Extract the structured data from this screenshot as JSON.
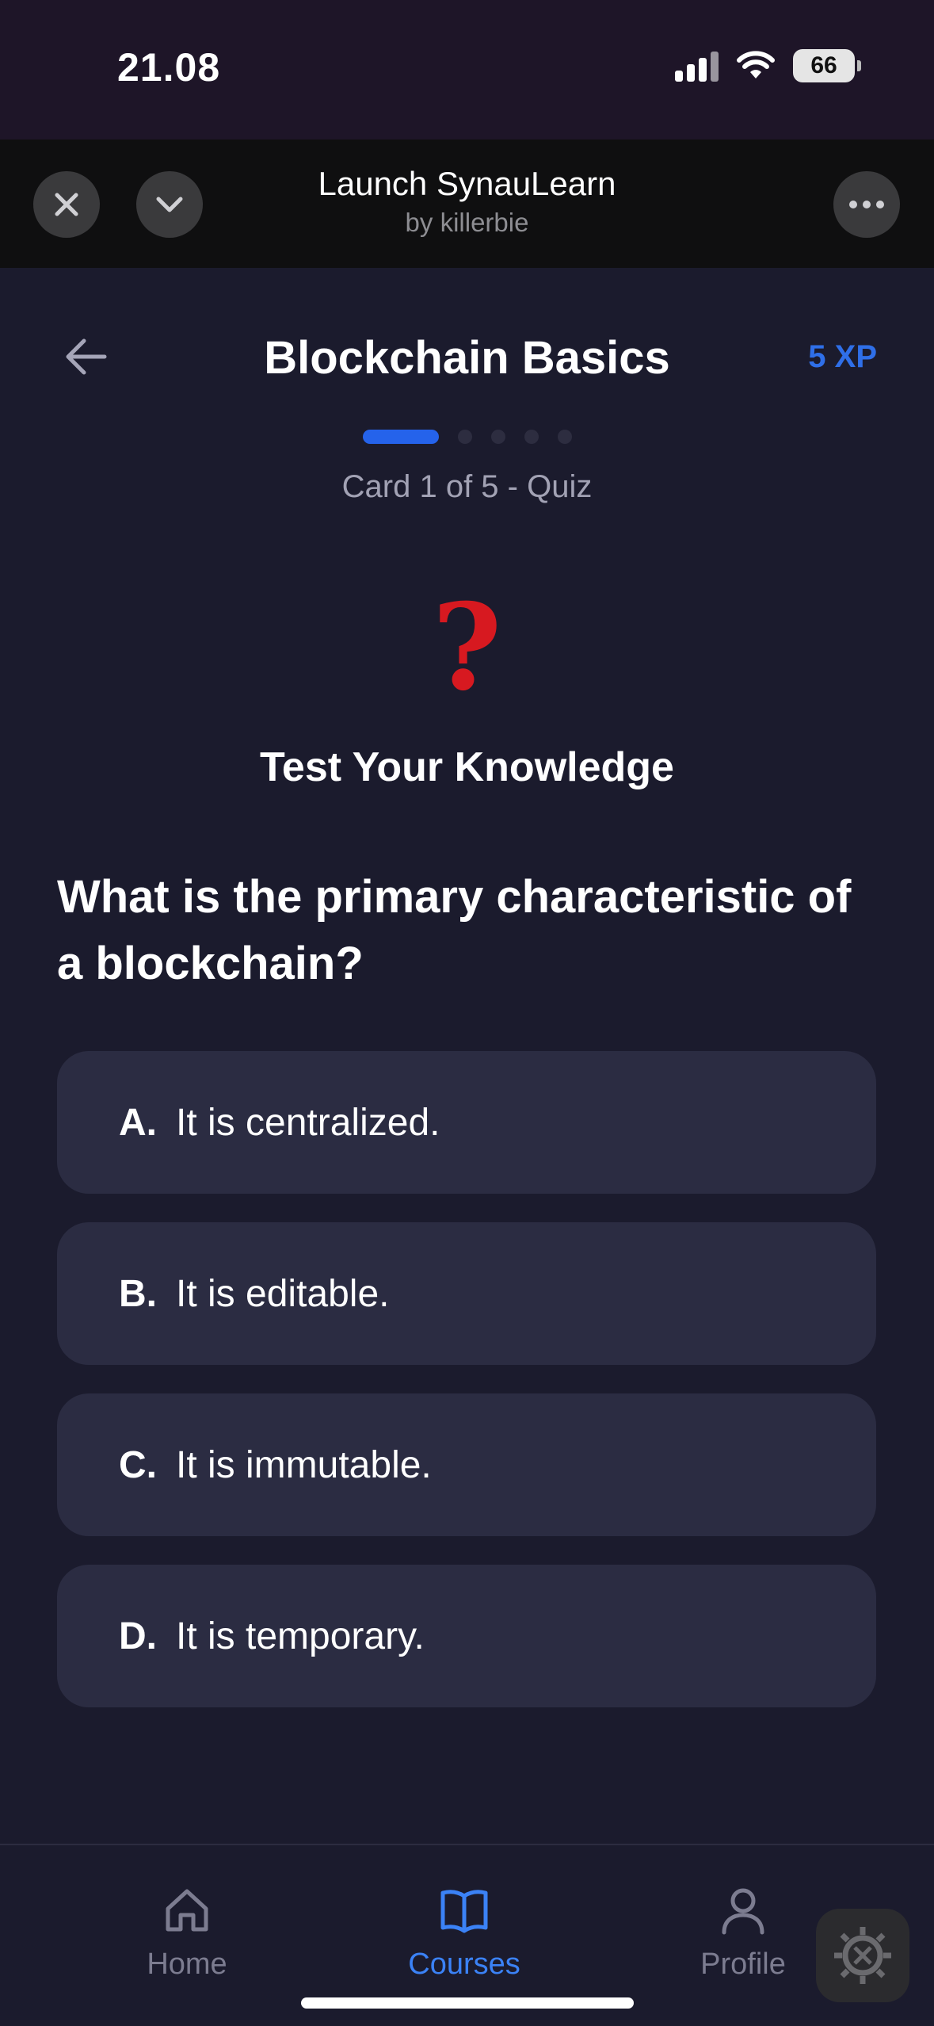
{
  "status_bar": {
    "time": "21.08",
    "battery": "66"
  },
  "mini_bar": {
    "title": "Launch SynauLearn",
    "subtitle": "by killerbie"
  },
  "header": {
    "title": "Blockchain Basics",
    "xp": "5 XP",
    "card_label": "Card 1 of 5 - Quiz"
  },
  "quiz": {
    "icon": "?",
    "section_title": "Test Your Knowledge",
    "question": "What is the primary characteristic of a blockchain?",
    "options": [
      {
        "letter": "A.",
        "text": "It is centralized."
      },
      {
        "letter": "B.",
        "text": "It is editable."
      },
      {
        "letter": "C.",
        "text": "It is immutable."
      },
      {
        "letter": "D.",
        "text": "It is temporary."
      }
    ]
  },
  "tab_bar": {
    "tabs": [
      {
        "label": "Home",
        "icon": "home-icon"
      },
      {
        "label": "Courses",
        "icon": "book-icon"
      },
      {
        "label": "Profile",
        "icon": "user-icon"
      }
    ],
    "active_tab": "Courses"
  },
  "colors": {
    "accent": "#2563eb",
    "background": "#1b1b2d",
    "option_bg": "#2b2c42",
    "question_mark": "#d71920"
  }
}
